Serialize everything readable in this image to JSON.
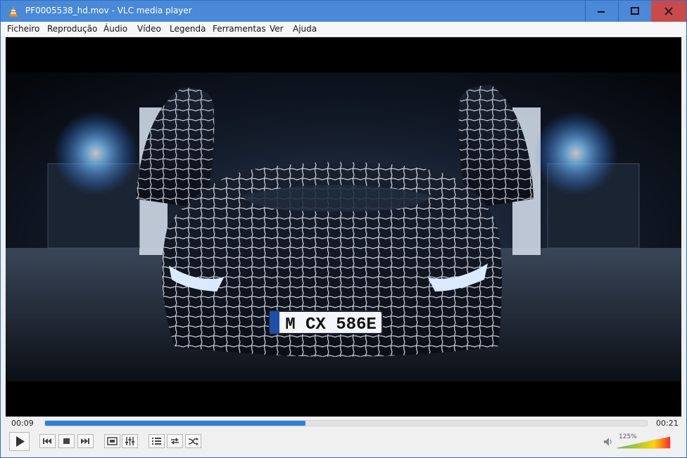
{
  "window": {
    "title": "PF0005538_hd.mov - VLC media player",
    "controls": [
      "minimize",
      "maximize",
      "close"
    ]
  },
  "menu": {
    "items": [
      "Ficheiro",
      "Reprodução",
      "Áudio",
      "Vídeo",
      "Legenda",
      "Ferramentas",
      "Ver",
      "Ajuda"
    ]
  },
  "player": {
    "elapsed": "00:09",
    "total": "00:21",
    "progress": 0.433,
    "volume_label": "125%",
    "volume_level": 1.25
  },
  "video": {
    "license_plate": "M CX 586E"
  },
  "icons": {
    "app": "vlc-cone-icon",
    "play": "play-icon",
    "prev": "previous-icon",
    "stop": "stop-icon",
    "next": "next-icon",
    "fullscreen": "fullscreen-icon",
    "extended": "extended-settings-icon",
    "playlist": "playlist-icon",
    "loop": "loop-icon",
    "shuffle": "shuffle-icon",
    "volume": "volume-icon"
  },
  "colors": {
    "titlebar": "#4a88d8",
    "close": "#c94a4a",
    "seek_fill": "#2e7fdc"
  }
}
